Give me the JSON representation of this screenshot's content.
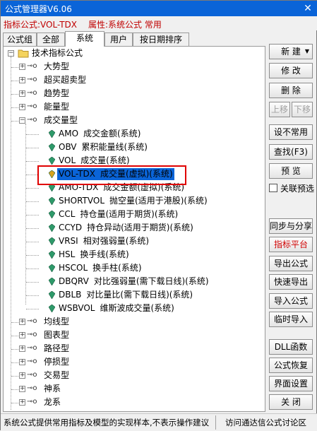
{
  "window": {
    "title": "公式管理器V6.06",
    "close_glyph": "✕"
  },
  "infobar": {
    "indicator_label": "指标公式:VOL-TDX",
    "attribute_label": "属性:系统公式 常用"
  },
  "tabs": [
    {
      "label": "公式组"
    },
    {
      "label": "全部"
    },
    {
      "label": "系统"
    },
    {
      "label": "用户"
    },
    {
      "label": "按日期排序"
    }
  ],
  "active_tab": "系统",
  "tree": {
    "root_label": "技术指标公式",
    "groups": [
      {
        "label": "大势型"
      },
      {
        "label": "超买超卖型"
      },
      {
        "label": "趋势型"
      },
      {
        "label": "能量型"
      },
      {
        "label": "成交量型"
      }
    ],
    "items": [
      {
        "code": "AMO",
        "desc": "成交金额(系统)"
      },
      {
        "code": "OBV",
        "desc": "累积能量线(系统)"
      },
      {
        "code": "VOL",
        "desc": "成交量(系统)"
      },
      {
        "code": "VOL-TDX",
        "desc": "成交量(虚拟)(系统)"
      },
      {
        "code": "AMO-TDX",
        "desc": "成交金额(虚拟)(系统)"
      },
      {
        "code": "SHORTVOL",
        "desc": "抛空量(适用于港股)(系统)"
      },
      {
        "code": "CCL",
        "desc": "持仓量(适用于期货)(系统)"
      },
      {
        "code": "CCYD",
        "desc": "持仓异动(适用于期货)(系统)"
      },
      {
        "code": "VRSI",
        "desc": "相对强弱量(系统)"
      },
      {
        "code": "HSL",
        "desc": "换手线(系统)"
      },
      {
        "code": "HSCOL",
        "desc": "换手柱(系统)"
      },
      {
        "code": "DBQRV",
        "desc": "对比强弱量(需下载日线)(系统)"
      },
      {
        "code": "DBLB",
        "desc": "对比量比(需下载日线)(系统)"
      },
      {
        "code": "WSBVOL",
        "desc": "维斯波成交量(系统)"
      }
    ],
    "groups_after": [
      {
        "label": "均线型"
      },
      {
        "label": "图表型"
      },
      {
        "label": "路径型"
      },
      {
        "label": "停损型"
      },
      {
        "label": "交易型"
      },
      {
        "label": "神系"
      },
      {
        "label": "龙系"
      }
    ]
  },
  "buttons": {
    "new": "新 建",
    "new_arrow": "▼",
    "modify": "修 改",
    "delete": "删 除",
    "move_up": "上移",
    "move_down": "下移",
    "set_uncommon": "设不常用",
    "find": "查找(F3)",
    "preview": "预 览",
    "linked_preview": "关联预选",
    "sync_share": "同步与分享",
    "indicator_platform": "指标平台",
    "export_formula": "导出公式",
    "quick_export": "快速导出",
    "import_formula": "导入公式",
    "temp_import": "临时导入",
    "dll_function": "DLL函数",
    "restore_formula": "公式恢复",
    "ui_settings": "界面设置",
    "close": "关 闭"
  },
  "statusbar": {
    "left_text": "系统公式提供常用指标及模型的实现样本,不表示操作建议",
    "right_text": "访问通达信公式讨论区"
  },
  "colors": {
    "title_bg": "#0a64d8",
    "info_text": "#c00000",
    "selection_bg": "#0a64d8",
    "highlight_border": "#e00000",
    "platform_text": "#d00000"
  }
}
